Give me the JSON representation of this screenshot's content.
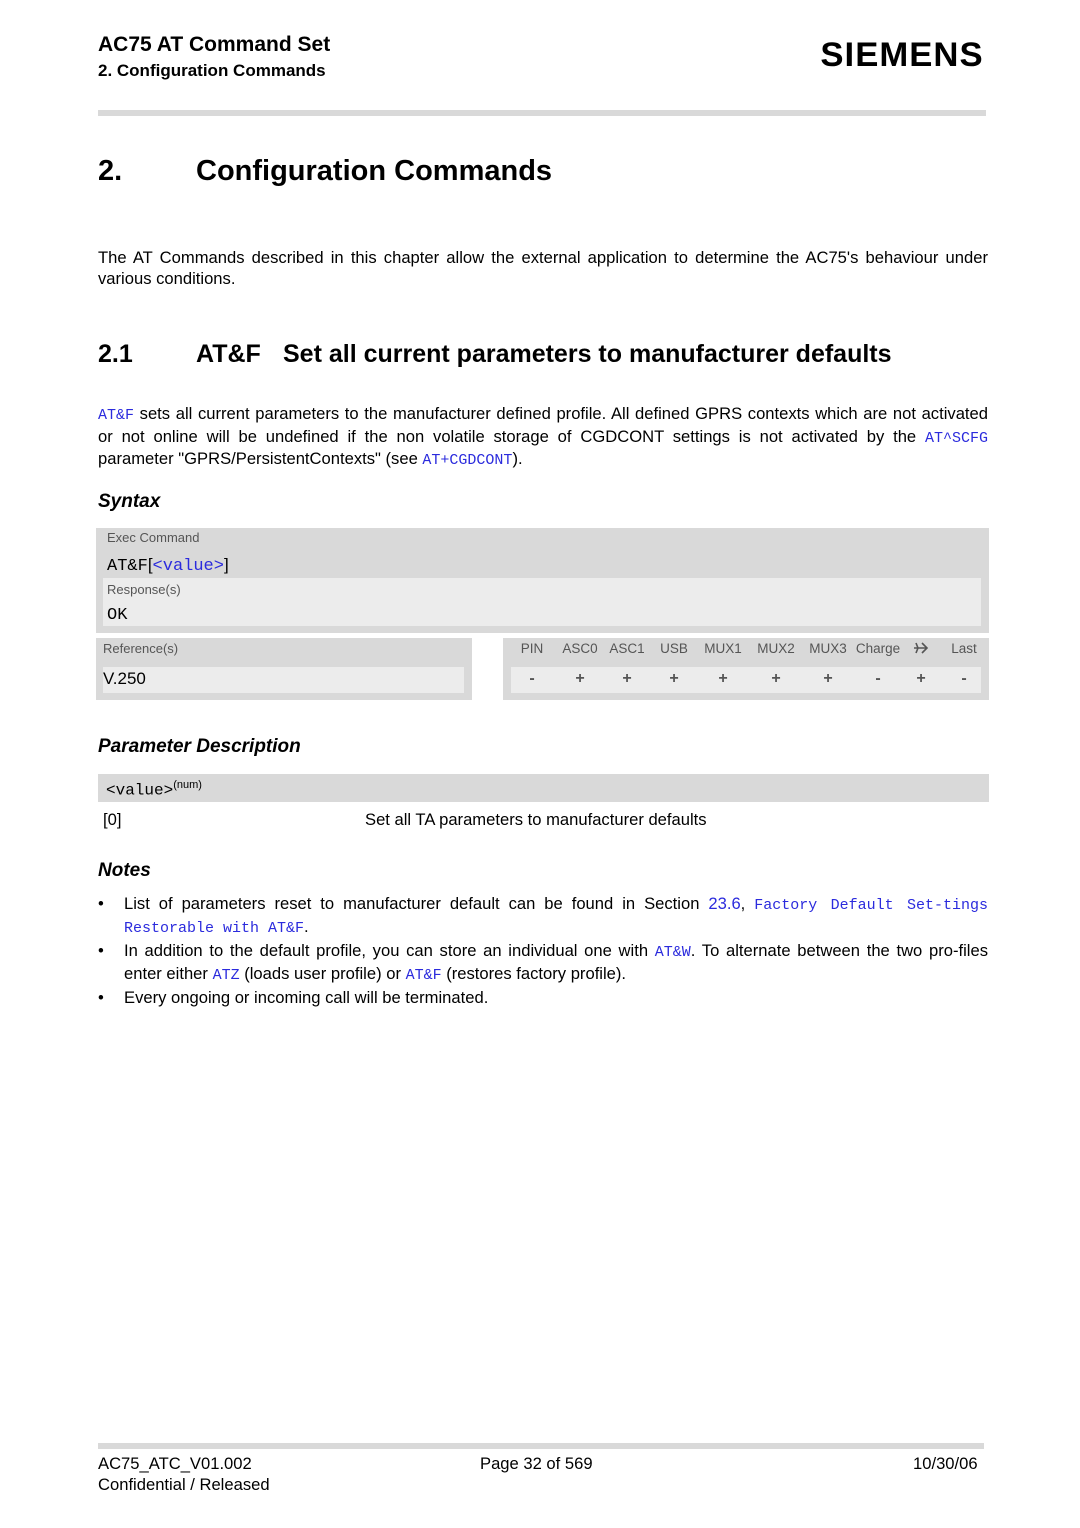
{
  "header": {
    "title": "AC75 AT Command Set",
    "subtitle": "2. Configuration Commands",
    "logo": "SIEMENS"
  },
  "chapter": {
    "number": "2.",
    "title": "Configuration Commands",
    "intro": "The AT Commands described in this chapter allow the external application to determine the AC75's behaviour under various conditions."
  },
  "section": {
    "number": "2.1",
    "command": "AT&F",
    "title": "Set all current parameters to manufacturer defaults",
    "desc_parts": {
      "cmd1": "AT&F",
      "text1": " sets all current parameters to the manufacturer defined profile. All defined GPRS contexts which are not activated or not online will be undefined if the non volatile storage of CGDCONT settings is not activated by the ",
      "cmd2": "AT^SCFG",
      "text2": " parameter \"GPRS/PersistentContexts\" (see ",
      "cmd3": "AT+CGDCONT",
      "text3": ")."
    }
  },
  "syntax": {
    "heading": "Syntax",
    "exec_label": "Exec Command",
    "exec_cmd": "AT&F",
    "exec_bracket_open": "[",
    "exec_param": "<value>",
    "exec_bracket_close": "]",
    "response_label": "Response(s)",
    "response": "OK",
    "reference_label": "Reference(s)",
    "reference": "V.250",
    "ports": [
      {
        "name": "PIN",
        "value": "-"
      },
      {
        "name": "ASC0",
        "value": "+"
      },
      {
        "name": "ASC1",
        "value": "+"
      },
      {
        "name": "USB",
        "value": "+"
      },
      {
        "name": "MUX1",
        "value": "+"
      },
      {
        "name": "MUX2",
        "value": "+"
      },
      {
        "name": "MUX3",
        "value": "+"
      },
      {
        "name": "Charge",
        "value": "-"
      },
      {
        "name": "airplane-icon",
        "value": "+"
      },
      {
        "name": "Last",
        "value": "-"
      }
    ]
  },
  "parameters": {
    "heading": "Parameter Description",
    "name": "<value>",
    "type": "(num)",
    "values": [
      {
        "value": "[0]",
        "description": "Set all TA parameters to manufacturer defaults"
      }
    ]
  },
  "notes": {
    "heading": "Notes",
    "bullet": "•",
    "items": [
      {
        "t1": "List of parameters reset to manufacturer default can be found in Section ",
        "l1": "23.6",
        "t2": ", ",
        "l2": "Factory Default Set-tings Restorable with AT&F",
        "t3": "."
      },
      {
        "t1": "In addition to the default profile, you can store an individual one with ",
        "l1": "AT&W",
        "t2": ". To alternate between the two pro-files enter either ",
        "l2": "ATZ",
        "t3": " (loads user profile) or ",
        "l3": "AT&F",
        "t4": " (restores factory profile)."
      },
      {
        "t1": "Every ongoing or incoming call will be terminated."
      }
    ]
  },
  "footer": {
    "doc_id": "AC75_ATC_V01.002",
    "page": "Page 32 of 569",
    "date": "10/30/06",
    "classification": "Confidential / Released"
  }
}
